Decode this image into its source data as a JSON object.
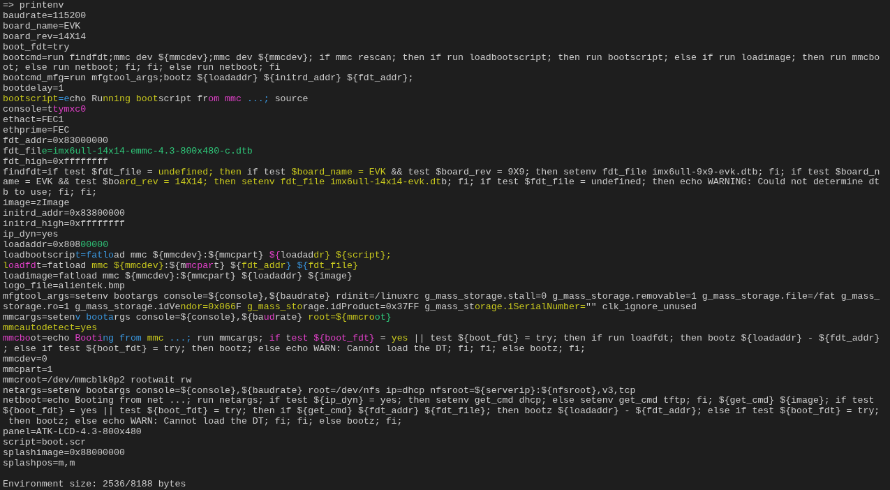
{
  "terminal": {
    "lines": [
      {
        "segments": [
          {
            "text": "=> printenv"
          }
        ]
      },
      {
        "segments": [
          {
            "text": "baudrate=115200"
          }
        ]
      },
      {
        "segments": [
          {
            "text": "board_name=EVK"
          }
        ]
      },
      {
        "segments": [
          {
            "text": "board_rev=14X14"
          }
        ]
      },
      {
        "segments": [
          {
            "text": "boot_fdt=try"
          }
        ]
      },
      {
        "segments": [
          {
            "text": "bootcmd=run findfdt;mmc dev ${mmcdev};mmc dev ${mmcdev}; if mmc rescan; then if run loadbootscript; then run bootscript; else if run loadimage; then run mmcbo"
          }
        ]
      },
      {
        "segments": [
          {
            "text": "ot; else run netboot; fi; fi; else run netboot; fi"
          }
        ]
      },
      {
        "segments": [
          {
            "text": "bootcmd_mfg=run mfgtool_args;bootz ${loadaddr} ${initrd_addr} ${fdt_addr};"
          }
        ]
      },
      {
        "segments": [
          {
            "text": "bootdelay=1"
          }
        ]
      },
      {
        "segments": [
          {
            "text": "bootscript",
            "color": "#c8c81e"
          },
          {
            "text": "=e",
            "color": "#3a96dd"
          },
          {
            "text": "cho Ru"
          },
          {
            "text": "nning ",
            "color": "#c8c81e"
          },
          {
            "text": "boot",
            "color": "#c8c81e"
          },
          {
            "text": "script fr"
          },
          {
            "text": "om mmc",
            "color": "#e040c8"
          },
          {
            "text": " ...;",
            "color": "#3a96dd"
          },
          {
            "text": " source"
          }
        ]
      },
      {
        "segments": [
          {
            "text": "console=t"
          },
          {
            "text": "tymxc0",
            "color": "#e040c8"
          }
        ]
      },
      {
        "segments": [
          {
            "text": "ethact=FEC1"
          }
        ]
      },
      {
        "segments": [
          {
            "text": "ethprime=FEC"
          }
        ]
      },
      {
        "segments": [
          {
            "text": "fdt_addr=0x83000000"
          }
        ]
      },
      {
        "segments": [
          {
            "text": "fdt_fil"
          },
          {
            "text": "e=imx6ull-14x14-emmc-4.3-800x480-c.dtb",
            "color": "#2fc87a"
          }
        ]
      },
      {
        "segments": [
          {
            "text": "fdt_high=0xffffffff"
          }
        ]
      },
      {
        "segments": [
          {
            "text": "findfdt=if test $fdt_file = "
          },
          {
            "text": "undefined; then",
            "color": "#c8c81e"
          },
          {
            "text": " if test "
          },
          {
            "text": "$board_name = EVK",
            "color": "#c8c81e"
          },
          {
            "text": " && test $board_rev = 9X9; then setenv fdt_file imx6ull-9x9-evk.dtb; fi; if test $board_n"
          }
        ]
      },
      {
        "segments": [
          {
            "text": "ame = EVK && test $bo"
          },
          {
            "text": "ard_rev = 14X14; then setenv fdt_file imx6ull-14x14-evk.dt",
            "color": "#c8c81e"
          },
          {
            "text": "b; fi; if test $fdt_file = undefined; then echo WARNING: Could not determine dt"
          }
        ]
      },
      {
        "segments": [
          {
            "text": "b to use; fi; fi;"
          }
        ]
      },
      {
        "segments": [
          {
            "text": "image=zImage"
          }
        ]
      },
      {
        "segments": [
          {
            "text": "initrd_addr=0x83800000"
          }
        ]
      },
      {
        "segments": [
          {
            "text": "initrd_high=0xffffffff"
          }
        ]
      },
      {
        "segments": [
          {
            "text": "ip_dyn=yes"
          }
        ]
      },
      {
        "segments": [
          {
            "text": "loadaddr=0x808"
          },
          {
            "text": "00000",
            "color": "#2fc87a"
          }
        ]
      },
      {
        "segments": [
          {
            "text": "loadbootscrip"
          },
          {
            "text": "t=fatlo",
            "color": "#3a96dd"
          },
          {
            "text": "ad mmc ${mmcdev}:${mmcpart} "
          },
          {
            "text": "${",
            "color": "#e040c8"
          },
          {
            "text": "loadad"
          },
          {
            "text": "dr} ${script};",
            "color": "#c8c81e"
          }
        ]
      },
      {
        "segments": [
          {
            "text": "l",
            "color": "#c8c81e"
          },
          {
            "text": "oadfd",
            "color": "#e040c8"
          },
          {
            "text": "t=fatload "
          },
          {
            "text": "mmc ${mmcdev}",
            "color": "#c8c81e"
          },
          {
            "text": ":${m"
          },
          {
            "text": "mcpar",
            "color": "#e040c8"
          },
          {
            "text": "t} ${"
          },
          {
            "text": "fdt_addr",
            "color": "#c8c81e"
          },
          {
            "text": "} ${",
            "color": "#3a96dd"
          },
          {
            "text": "fdt_file}",
            "color": "#c8c81e"
          }
        ]
      },
      {
        "segments": [
          {
            "text": "loadimage=fatload mmc ${mmcdev}:${mmcpart} ${loadaddr} ${image}"
          }
        ]
      },
      {
        "segments": [
          {
            "text": "logo_file=alientek.bmp"
          }
        ]
      },
      {
        "segments": [
          {
            "text": "mfgtool_args=setenv bootargs console=${console},${baudrate} rdinit=/linuxrc g_mass_storage.stall=0 g_mass_storage.removable=1 g_mass_storage.file=/fat g_mass_"
          }
        ]
      },
      {
        "segments": [
          {
            "text": "storage.ro=1 g_mass_storage.idVe"
          },
          {
            "text": "ndor=0x066",
            "color": "#c8c81e"
          },
          {
            "text": "F "
          },
          {
            "text": "g_mass_sto",
            "color": "#c8c81e"
          },
          {
            "text": "rage.idProduct=0x37FF g_mass_st"
          },
          {
            "text": "orage.iSerialNumber=",
            "color": "#c8c81e"
          },
          {
            "text": "\"\" clk_ignore_unused"
          }
        ]
      },
      {
        "segments": [
          {
            "text": "mmcargs=seten"
          },
          {
            "text": "v boota",
            "color": "#3a96dd"
          },
          {
            "text": "rgs console=${console},${ba"
          },
          {
            "text": "ud",
            "color": "#e040c8"
          },
          {
            "text": "rate} "
          },
          {
            "text": "root=${mmcro",
            "color": "#c8c81e"
          },
          {
            "text": "ot}",
            "color": "#2fc87a"
          }
        ]
      },
      {
        "segments": [
          {
            "text": "mmcautodetect=yes",
            "color": "#c8c81e"
          }
        ]
      },
      {
        "segments": [
          {
            "text": "mmcbo",
            "color": "#e040c8"
          },
          {
            "text": "ot=echo "
          },
          {
            "text": "Booti",
            "color": "#e040c8"
          },
          {
            "text": "ng from ",
            "color": "#3a96dd"
          },
          {
            "text": "mmc",
            "color": "#c8c81e"
          },
          {
            "text": " ...;",
            "color": "#3a96dd"
          },
          {
            "text": " run mmcargs; "
          },
          {
            "text": "if",
            "color": "#e040c8"
          },
          {
            "text": " t"
          },
          {
            "text": "est ${boot_fdt}",
            "color": "#e040c8"
          },
          {
            "text": " = "
          },
          {
            "text": "yes",
            "color": "#c8c81e"
          },
          {
            "text": " || test ${boot_fdt} = try; then if run loadfdt; then bootz ${loadaddr} - ${fdt_addr}"
          }
        ]
      },
      {
        "segments": [
          {
            "text": "; else if test ${boot_fdt} = try; then bootz; else echo WARN: Cannot load the DT; fi; fi; else bootz; fi;"
          }
        ]
      },
      {
        "segments": [
          {
            "text": "mmcdev=0"
          }
        ]
      },
      {
        "segments": [
          {
            "text": "mmcpart=1"
          }
        ]
      },
      {
        "segments": [
          {
            "text": "mmcroot=/dev/mmcblk0p2 rootwait rw"
          }
        ]
      },
      {
        "segments": [
          {
            "text": "netargs=setenv bootargs console=${console},${baudrate} root=/dev/nfs ip=dhcp nfsroot=${serverip}:${nfsroot},v3,tcp"
          }
        ]
      },
      {
        "segments": [
          {
            "text": "netboot=echo Booting from net ...; run netargs; if test ${ip_dyn} = yes; then setenv get_cmd dhcp; else setenv get_cmd tftp; fi; ${get_cmd} ${image}; if test"
          }
        ]
      },
      {
        "segments": [
          {
            "text": "${boot_fdt} = yes || test ${boot_fdt} = try; then if ${get_cmd} ${fdt_addr} ${fdt_file}; then bootz ${loadaddr} - ${fdt_addr}; else if test ${boot_fdt} = try;"
          }
        ]
      },
      {
        "segments": [
          {
            "text": " then bootz; else echo WARN: Cannot load the DT; fi; fi; else bootz; fi;"
          }
        ]
      },
      {
        "segments": [
          {
            "text": "panel=ATK-LCD-4.3-800x480"
          }
        ]
      },
      {
        "segments": [
          {
            "text": "script=boot.scr"
          }
        ]
      },
      {
        "segments": [
          {
            "text": "splashimage=0x88000000"
          }
        ]
      },
      {
        "segments": [
          {
            "text": "splashpos=m,m"
          }
        ]
      },
      {
        "segments": [
          {
            "text": "Environment size: 2536/8188 bytes"
          }
        ],
        "blank_before": true
      }
    ]
  }
}
